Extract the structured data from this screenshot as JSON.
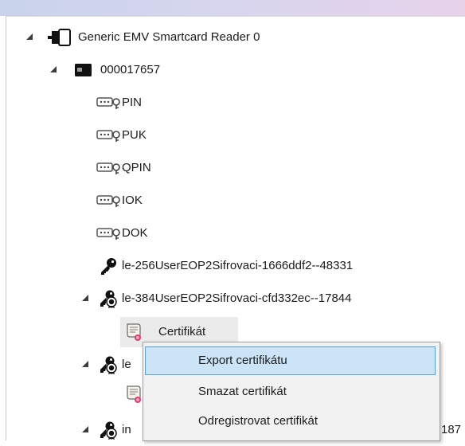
{
  "tree": {
    "reader": {
      "label": "Generic EMV Smartcard Reader 0",
      "icon": "card-reader-icon"
    },
    "card": {
      "label": "000017657",
      "icon": "smartcard-icon"
    },
    "pins": [
      {
        "label": "PIN",
        "icon": "pin-key-icon"
      },
      {
        "label": "PUK",
        "icon": "pin-key-icon"
      },
      {
        "label": "QPIN",
        "icon": "pin-key-icon"
      },
      {
        "label": "IOK",
        "icon": "pin-key-icon"
      },
      {
        "label": "DOK",
        "icon": "pin-key-icon"
      }
    ],
    "key1": {
      "label": "le-256UserEOP2Sifrovaci-1666ddf2--48331",
      "icon": "private-key-icon"
    },
    "key2": {
      "label": "le-384UserEOP2Sifrovaci-cfd332ec--17844",
      "icon": "key-certificate-icon"
    },
    "cert": {
      "label": "Certifikát",
      "icon": "certificate-icon"
    },
    "key3_partial": {
      "label": "le"
    },
    "key4_partial": {
      "label": "in",
      "suffix": "187"
    }
  },
  "context_menu": {
    "items": [
      {
        "label": "Export certifikátu",
        "highlighted": true
      },
      {
        "label": "Smazat certifikát"
      },
      {
        "label": "Odregistrovat certifikát"
      }
    ]
  },
  "colors": {
    "highlight_fill": "#cce4f7",
    "highlight_border": "#5aa0dc",
    "menu_bg": "#f2f2f2"
  }
}
